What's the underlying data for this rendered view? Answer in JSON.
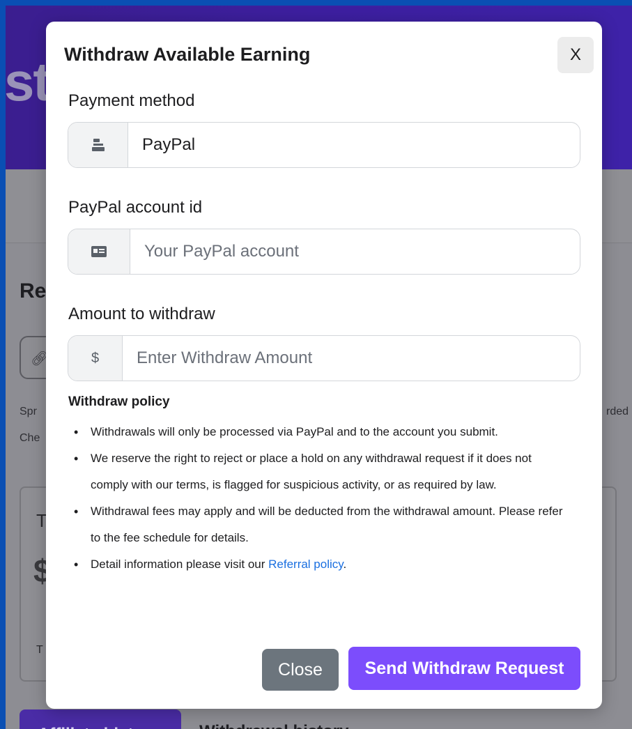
{
  "background": {
    "hero_text": "st",
    "heading": "Re",
    "link_icon": "link-icon",
    "text_left_1": "Spr",
    "text_left_2": "Che",
    "text_right": "rded",
    "card_text_1": "T",
    "card_text_2": "$",
    "card_text_3": "T",
    "tab_active_label": "Affiliate history",
    "tab_label": "Withdrawal history"
  },
  "modal": {
    "title": "Withdraw Available Earning",
    "close_x_label": "X",
    "payment_method": {
      "label": "Payment method",
      "icon": "bank-icon",
      "value": "PayPal"
    },
    "paypal_account": {
      "label": "PayPal account id",
      "icon": "id-card-icon",
      "placeholder": "Your PayPal account"
    },
    "amount": {
      "label": "Amount to withdraw",
      "icon_text": "$",
      "placeholder": "Enter Withdraw Amount"
    },
    "policy": {
      "title": "Withdraw policy",
      "items": [
        "Withdrawals will only be processed via PayPal and to the account you submit.",
        "We reserve the right to reject or place a hold on any withdrawal request if it does not comply with our terms, is flagged for suspicious activity, or as required by law.",
        "Withdrawal fees may apply and will be deducted from the withdrawal amount. Please refer to the fee schedule for details."
      ],
      "last_item_prefix": "Detail information please visit our ",
      "last_item_link": "Referral policy",
      "last_item_suffix": "."
    },
    "close_button": "Close",
    "send_button": "Send Withdraw Request"
  },
  "colors": {
    "outer_border": "#0a4fb3",
    "header_purple": "#3d1fa0",
    "send_button": "#7c4dfc",
    "close_button": "#6c757d",
    "link": "#1a6fe0"
  }
}
